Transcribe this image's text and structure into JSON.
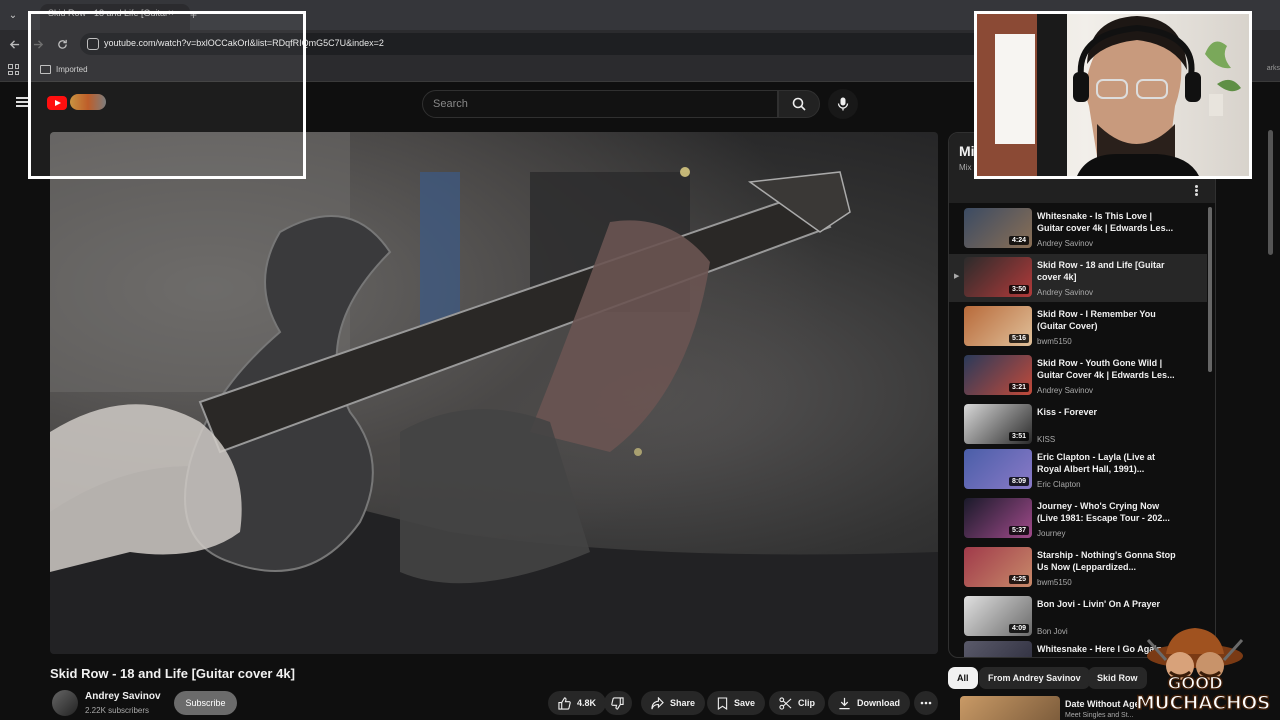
{
  "browser": {
    "tab_title": "Skid Row - 18 and Life [Guitar",
    "tab_close": "×",
    "new_tab": "+",
    "url": "youtube.com/watch?v=bxlOCCakOrI&list=RDqfRIQmG5C7U&index=2",
    "bookmark_folder": "Imported",
    "bookmarks_more": "arks"
  },
  "header": {
    "search_placeholder": "Search"
  },
  "video": {
    "title": "Skid Row - 18 and Life [Guitar cover 4k]",
    "channel": "Andrey Savinov",
    "subscribers": "2.22K subscribers",
    "subscribe_label": "Subscribe",
    "like_count": "4.8K",
    "share_label": "Share",
    "save_label": "Save",
    "clip_label": "Clip",
    "download_label": "Download"
  },
  "playlist": {
    "title": "Mi",
    "subtitle": "Mix",
    "items": [
      {
        "title": "Whitesnake - Is This Love | Guitar cover 4k | Edwards Les...",
        "channel": "Andrey Savinov",
        "duration": "4:24",
        "index": "",
        "colors": [
          "#3b4b63",
          "#8a6f55"
        ]
      },
      {
        "title": "Skid Row - 18 and Life [Guitar cover 4k]",
        "channel": "Andrey Savinov",
        "duration": "3:50",
        "index": "▶",
        "colors": [
          "#2b2b2b",
          "#b23a3a"
        ]
      },
      {
        "title": "Skid Row - I Remember You (Guitar Cover)",
        "channel": "bwm5150",
        "duration": "5:16",
        "index": "",
        "colors": [
          "#b86a3a",
          "#e0c09a"
        ]
      },
      {
        "title": "Skid Row - Youth Gone Wild | Guitar Cover 4k | Edwards Les...",
        "channel": "Andrey Savinov",
        "duration": "3:21",
        "index": "",
        "colors": [
          "#2a3a5a",
          "#c24a3a"
        ]
      },
      {
        "title": "Kiss - Forever",
        "channel": "KISS",
        "duration": "3:51",
        "index": "",
        "colors": [
          "#d8d8d8",
          "#2a2a2a"
        ]
      },
      {
        "title": "Eric Clapton - Layla (Live at Royal Albert Hall, 1991)...",
        "channel": "Eric Clapton",
        "duration": "8:09",
        "index": "",
        "colors": [
          "#4a5ea8",
          "#8a7ac8"
        ]
      },
      {
        "title": "Journey - Who's Crying Now (Live 1981: Escape Tour - 202...",
        "channel": "Journey",
        "duration": "5:37",
        "index": "",
        "colors": [
          "#1a1a2a",
          "#a04a8a"
        ]
      },
      {
        "title": "Starship - Nothing's Gonna Stop Us Now (Leppardized...",
        "channel": "bwm5150",
        "duration": "4:25",
        "index": "",
        "colors": [
          "#a03a4a",
          "#c88a6a"
        ]
      },
      {
        "title": "Bon Jovi - Livin' On A Prayer",
        "channel": "Bon Jovi",
        "duration": "4:09",
        "index": "",
        "colors": [
          "#e0e0e0",
          "#6a6a6a"
        ]
      },
      {
        "title": "Whitesnake - Here I Go Again",
        "channel": "",
        "duration": "",
        "index": "",
        "colors": [
          "#5a5a6a",
          "#2a2a3a"
        ]
      }
    ]
  },
  "chips": [
    "All",
    "From Andrey Savinov",
    "Skid Row"
  ],
  "recommendation": {
    "title": "Date Without Age",
    "subtitle": "Meet Singles and St..."
  },
  "watermark": {
    "line1": "GOOD",
    "line2": "MUCHACHOS"
  }
}
